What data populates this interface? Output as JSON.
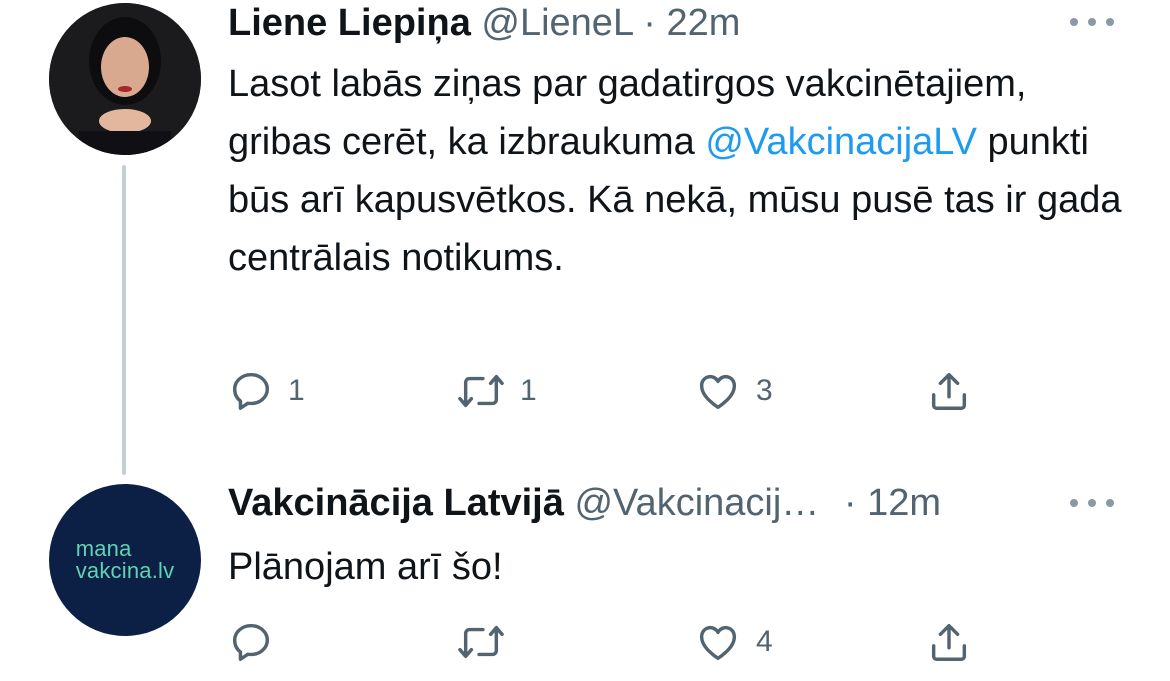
{
  "colors": {
    "link": "#1d9bf0",
    "secondary_text": "#536471",
    "thread_line": "#c4cfd6",
    "icon": "#536471"
  },
  "tweets": [
    {
      "name": "Liene Liepiņa",
      "handle": "@LieneL",
      "separator": "·",
      "time": "22m",
      "text_before": "Lasot labās ziņas par gadatirgos vakcinētajiem, gribas cerēt, ka izbraukuma ",
      "mention": "@VakcinacijaLV",
      "text_after": " punkti būs arī kapusvētkos. Kā nekā, mūsu pusē tas ir gada centrālais notikums.",
      "replies": "1",
      "retweets": "1",
      "likes": "3"
    },
    {
      "name": "Vakcinācija Latvijā",
      "handle": "@Vakcinacij…",
      "separator": "·",
      "time": "12m",
      "avatar_text_line1": "mana",
      "avatar_text_line2": "vakcina.lv",
      "text": "Plānojam arī šo!",
      "replies": "",
      "retweets": "",
      "likes": "4"
    }
  ],
  "icons": [
    "reply-icon",
    "retweet-icon",
    "like-icon",
    "share-icon",
    "more-icon"
  ]
}
